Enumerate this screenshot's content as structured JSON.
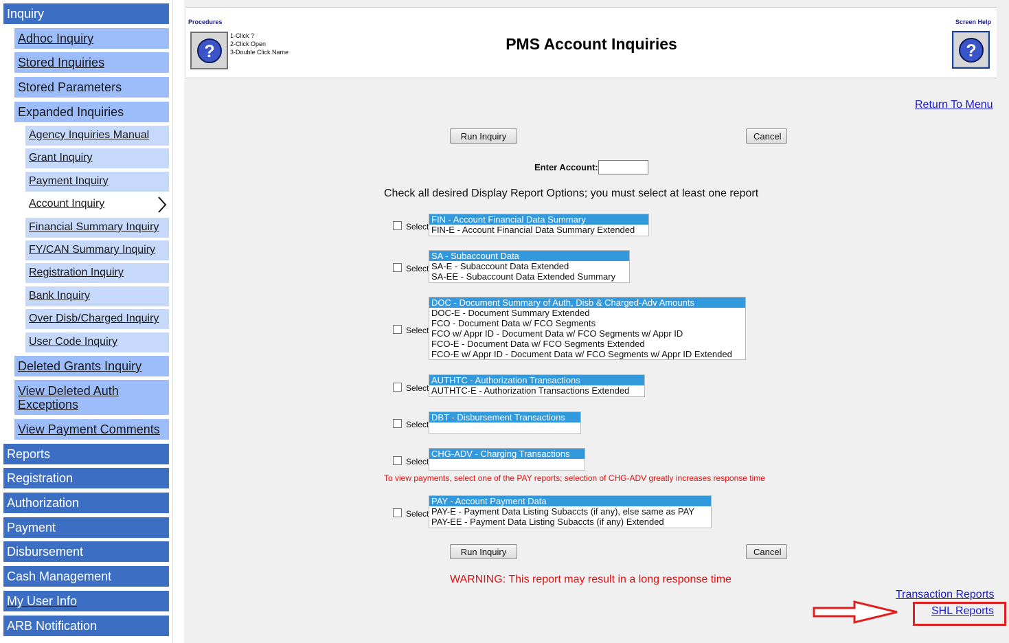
{
  "sidebar": {
    "inquiry": "Inquiry",
    "adhoc": "Adhoc Inquiry",
    "stored_inquiries": "Stored Inquiries",
    "stored_parameters": "Stored Parameters",
    "expanded_inquiries": "Expanded Inquiries",
    "expanded_items": [
      "Agency Inquiries Manual",
      "Grant Inquiry",
      "Payment Inquiry",
      "Account Inquiry",
      "Financial Summary Inquiry",
      "FY/CAN Summary Inquiry",
      "Registration Inquiry",
      "Bank Inquiry",
      "Over Disb/Charged Inquiry",
      "User Code Inquiry"
    ],
    "deleted_grants": "Deleted Grants Inquiry",
    "view_deleted_auth": "View Deleted Auth Exceptions",
    "view_payment_comments": "View Payment Comments",
    "reports": "Reports",
    "registration": "Registration",
    "authorization": "Authorization",
    "payment": "Payment",
    "disbursement": "Disbursement",
    "cash_management": "Cash Management",
    "my_user_info": "My User Info",
    "arb_notification": "ARB Notification"
  },
  "header": {
    "procedures": "Procedures",
    "screen_help": "Screen Help",
    "steps": [
      "1-Click ?",
      "2-Click Open",
      "3-Double Click Name"
    ],
    "title": "PMS Account Inquiries",
    "help_icon": "question-icon"
  },
  "main": {
    "return_to_menu": "Return To Menu",
    "run_inquiry": "Run Inquiry",
    "cancel": "Cancel",
    "enter_account_label": "Enter Account:",
    "enter_account_value": "",
    "instructions": "Check all desired Display Report Options; you must select at least one report",
    "select_label": "Select",
    "report_groups": [
      {
        "options": [
          "FIN - Account Financial Data Summary",
          "FIN-E - Account Financial Data Summary Extended"
        ],
        "selected": 0
      },
      {
        "options": [
          "SA - Subaccount Data",
          "SA-E - Subaccount Data Extended",
          "SA-EE - Subaccount Data Extended Summary"
        ],
        "selected": 0
      },
      {
        "options": [
          "DOC - Document Summary of Auth, Disb & Charged-Adv Amounts",
          "DOC-E - Document Summary Extended",
          "FCO - Document Data w/ FCO Segments",
          "FCO w/ Appr ID - Document Data w/ FCO Segments w/ Appr ID",
          "FCO-E - Document Data w/ FCO Segments Extended",
          "FCO-E w/ Appr ID - Document Data w/ FCO Segments w/ Appr ID Extended"
        ],
        "selected": 0
      },
      {
        "options": [
          "AUTHTC - Authorization Transactions",
          "AUTHTC-E - Authorization Transactions Extended"
        ],
        "selected": 0
      },
      {
        "options": [
          "DBT - Disbursement Transactions"
        ],
        "selected": 0
      },
      {
        "options": [
          "CHG-ADV - Charging Transactions"
        ],
        "selected": 0
      },
      {
        "options": [
          "PAY - Account Payment Data",
          "PAY-E - Payment Data Listing Subaccts (if any), else same as PAY",
          "PAY-EE - Payment Data Listing Subaccts (if any) Extended"
        ],
        "selected": 0
      }
    ],
    "pay_note": "To view payments, select one of the PAY reports; selection of CHG-ADV greatly increases response time",
    "warning": "WARNING: This report may result in a long response time",
    "transaction_reports": "Transaction Reports",
    "shl_reports": "SHL Reports"
  },
  "colors": {
    "nav_top": "#3c6ec4",
    "nav_sub": "#9dbdfa",
    "nav_sub2": "#c6d9fb",
    "listbox_highlight": "#3399dd",
    "warning_red": "#e01010",
    "annotation_red": "#e02020",
    "link_blue": "#1a1acc"
  }
}
